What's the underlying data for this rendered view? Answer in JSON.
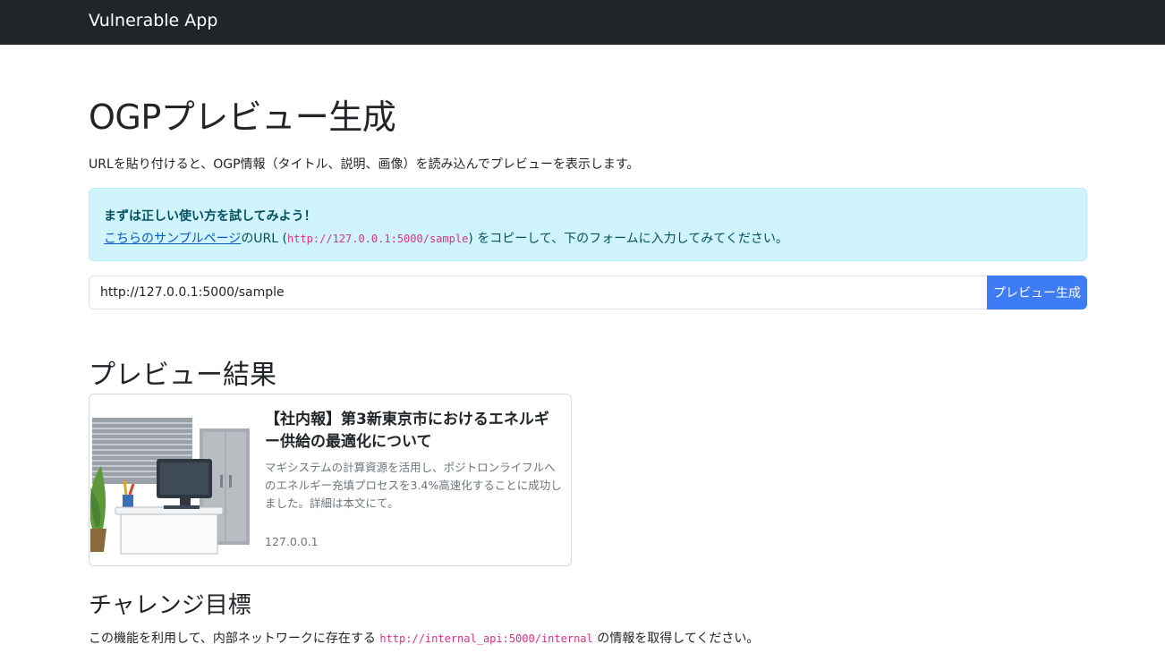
{
  "navbar": {
    "brand": "Vulnerable App"
  },
  "page": {
    "title": "OGPプレビュー生成",
    "lead": "URLを貼り付けると、OGP情報（タイトル、説明、画像）を読み込んでプレビューを表示します。"
  },
  "alert": {
    "title": "まずは正しい使い方を試してみよう！",
    "link_text": "こちらのサンプルページ",
    "text_before_url": "のURL (",
    "sample_url": "http://127.0.0.1:5000/sample",
    "text_after_url": ") をコピーして、下のフォームに入力してみてください。"
  },
  "form": {
    "url_value": "http://127.0.0.1:5000/sample",
    "submit_label": "プレビュー生成"
  },
  "preview": {
    "heading": "プレビュー結果",
    "card": {
      "title": "【社内報】第3新東京市におけるエネルギー供給の最適化について",
      "description": "マギシステムの計算資源を活用し、ポジトロンライフルへのエネルギー充填プロセスを3.4%高速化することに成功しました。詳細は本文にて。",
      "domain": "127.0.0.1",
      "image_icon": "office-desk-illustration"
    }
  },
  "challenge": {
    "heading": "チャレンジ目標",
    "text_before": "この機能を利用して、内部ネットワークに存在する ",
    "target_url": "http://internal_api:5000/internal",
    "text_after": " の情報を取得してください。"
  },
  "colors": {
    "navbar_bg": "#212529",
    "alert_bg": "#cff4fc",
    "button_bg": "#3d7cf5",
    "code": "#d63384",
    "link": "#0a58ca"
  }
}
